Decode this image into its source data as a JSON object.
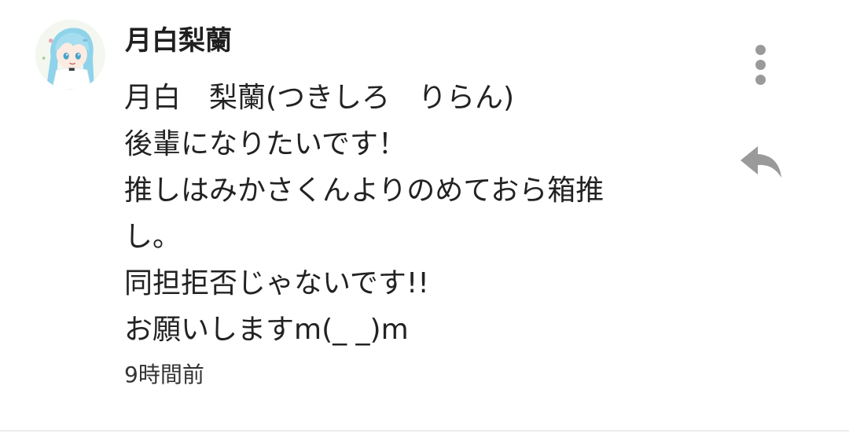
{
  "comment": {
    "avatar_icon": "user-avatar-anime-girl",
    "username": "月白梨蘭",
    "lines": [
      "月白　梨蘭(つきしろ　りらん)",
      "後輩になりたいです！",
      "推しはみかさくんよりのめておら箱推",
      "し。",
      "同担拒否じゃないです!!",
      "お願いしますm(_ _)m"
    ],
    "timestamp": "9時間前"
  },
  "actions": {
    "more_icon": "more-vertical-icon",
    "reply_icon": "reply-arrow-icon"
  },
  "colors": {
    "text": "#222222",
    "icon": "#9a9a9a",
    "divider": "#ececec"
  }
}
